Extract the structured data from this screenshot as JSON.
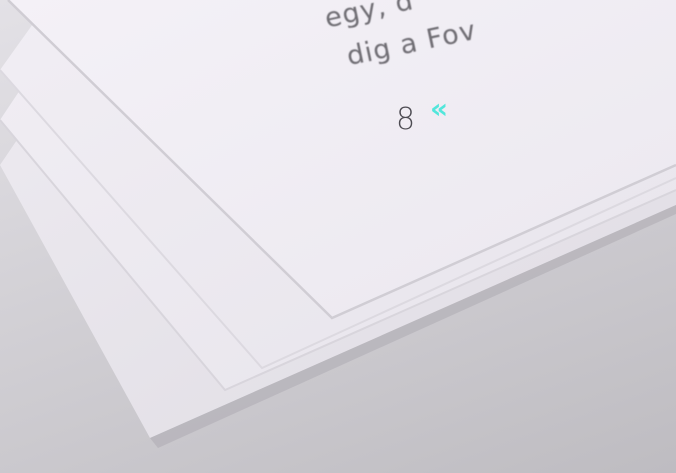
{
  "page_text": {
    "line_1": "egy, d",
    "line_2": "dig a Fov"
  },
  "page_number": "8",
  "page_chevron": "«",
  "colors": {
    "paper": "#f3f0f7",
    "text": "#6f6d73",
    "accent": "#52e6db",
    "background": "#c9c7cc"
  }
}
